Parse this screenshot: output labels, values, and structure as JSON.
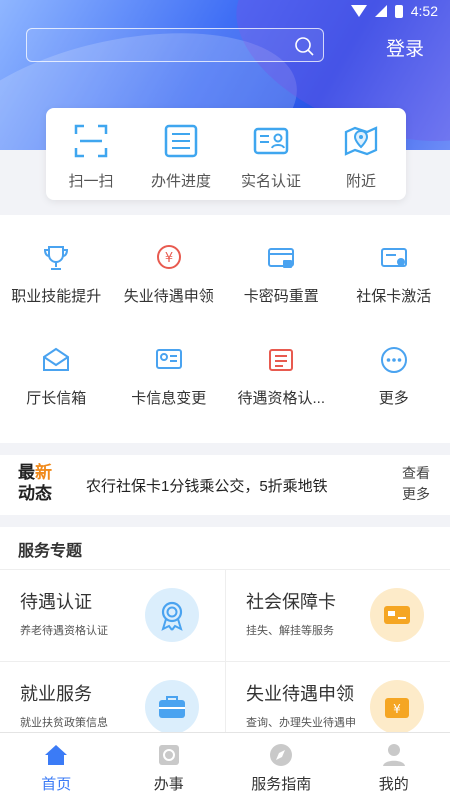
{
  "status_bar": {
    "time": "4:52"
  },
  "header": {
    "search_placeholder": "",
    "login_label": "登录"
  },
  "quick_actions": [
    {
      "label": "扫一扫",
      "icon": "scan-icon"
    },
    {
      "label": "办件进度",
      "icon": "progress-list-icon"
    },
    {
      "label": "实名认证",
      "icon": "id-card-icon"
    },
    {
      "label": "附近",
      "icon": "map-pin-icon"
    }
  ],
  "grid_services": [
    {
      "label": "职业技能提升",
      "icon": "trophy-icon"
    },
    {
      "label": "失业待遇申领",
      "icon": "money-hand-icon"
    },
    {
      "label": "卡密码重置",
      "icon": "card-lock-icon"
    },
    {
      "label": "社保卡激活",
      "icon": "card-check-icon"
    },
    {
      "label": "厅长信箱",
      "icon": "mail-icon"
    },
    {
      "label": "卡信息变更",
      "icon": "card-edit-icon"
    },
    {
      "label": "待遇资格认...",
      "icon": "document-icon"
    },
    {
      "label": "更多",
      "icon": "more-icon"
    }
  ],
  "news": {
    "tag_line1_a": "最",
    "tag_line1_b": "新",
    "tag_line2": "动态",
    "text": "农行社保卡1分钱乘公交，5折乘地铁",
    "more_line1": "查看",
    "more_line2": "更多"
  },
  "services_section": {
    "title": "服务专题",
    "items": [
      {
        "name": "待遇认证",
        "desc": "养老待遇资格认证",
        "icon": "award-icon"
      },
      {
        "name": "社会保障卡",
        "desc": "挂失、解挂等服务",
        "icon": "card-icon"
      },
      {
        "name": "就业服务",
        "desc": "就业扶贫政策信息",
        "icon": "briefcase-icon"
      },
      {
        "name": "失业待遇申领",
        "desc": "查询、办理失业待遇申",
        "icon": "yuan-box-icon"
      }
    ]
  },
  "tabs": [
    {
      "label": "首页",
      "icon": "home-icon",
      "active": true
    },
    {
      "label": "办事",
      "icon": "task-icon"
    },
    {
      "label": "服务指南",
      "icon": "compass-icon"
    },
    {
      "label": "我的",
      "icon": "user-icon"
    }
  ],
  "colors": {
    "primary": "#3b7bf6",
    "accent_blue": "#4aa3f0",
    "accent_red": "#e85a4f",
    "accent_orange": "#f5a623"
  }
}
